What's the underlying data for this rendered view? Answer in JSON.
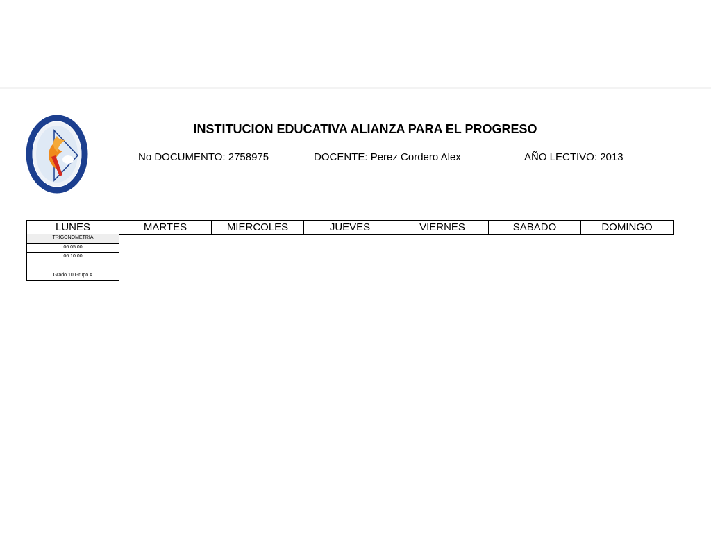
{
  "header": {
    "title": "INSTITUCION EDUCATIVA ALIANZA PARA EL PROGRESO",
    "doc_label": "No DOCUMENTO: ",
    "doc_value": "2758975",
    "teacher_label": "DOCENTE: ",
    "teacher_value": "Perez Cordero Alex",
    "year_label": "AÑO LECTIVO: ",
    "year_value": "2013"
  },
  "logo": {
    "icon": "school-crest-logo",
    "colors": {
      "ring": "#1c3f8f",
      "inner": "#dfe9f5",
      "flame": "#f08a1c",
      "accent": "#d62b1f"
    }
  },
  "schedule": {
    "days": [
      "LUNES",
      "MARTES",
      "MIERCOLES",
      "JUEVES",
      "VIERNES",
      "SABADO",
      "DOMINGO"
    ],
    "lunes": {
      "subject": "TRIGONOMETRIA",
      "start": "06:05:00",
      "end": "06:10:00",
      "blank": "",
      "group": "Grado 10 Grupo A"
    }
  }
}
